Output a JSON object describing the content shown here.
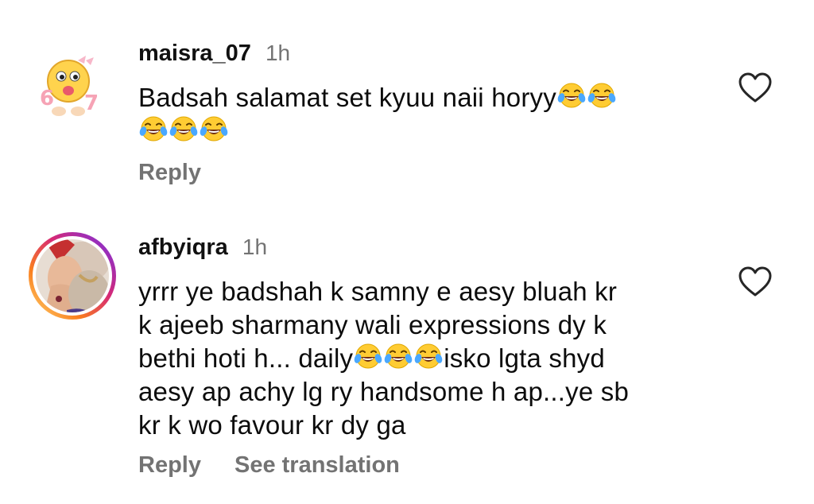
{
  "comments": [
    {
      "username": "maisra_07",
      "time": "1h",
      "text_lines": [
        "Badsah salamat set kyuu naii horyy",
        ""
      ],
      "reply_label": "Reply",
      "avatar_icon": "smiley-emoji-avatar"
    },
    {
      "username": "afbyiqra",
      "time": "1h",
      "text_lines": [
        "yrrr ye badshah k samny e aesy bluah kr",
        "k ajeeb sharmany wali expressions dy k",
        "bethi hoti h... daily",
        "isko lgta shyd",
        "aesy ap achy lg ry handsome h ap...ye sb",
        "kr k wo favour kr dy ga"
      ],
      "reply_label": "Reply",
      "translate_label": "See translation",
      "avatar_icon": "profile-photo-avatar",
      "story_ring_colors": [
        "#feda75",
        "#fa7e1e",
        "#d62976",
        "#962fbf",
        "#4f5bd5"
      ]
    }
  ],
  "emoji": "face-with-tears-of-joy-icon",
  "like_icon": "heart-outline-icon"
}
